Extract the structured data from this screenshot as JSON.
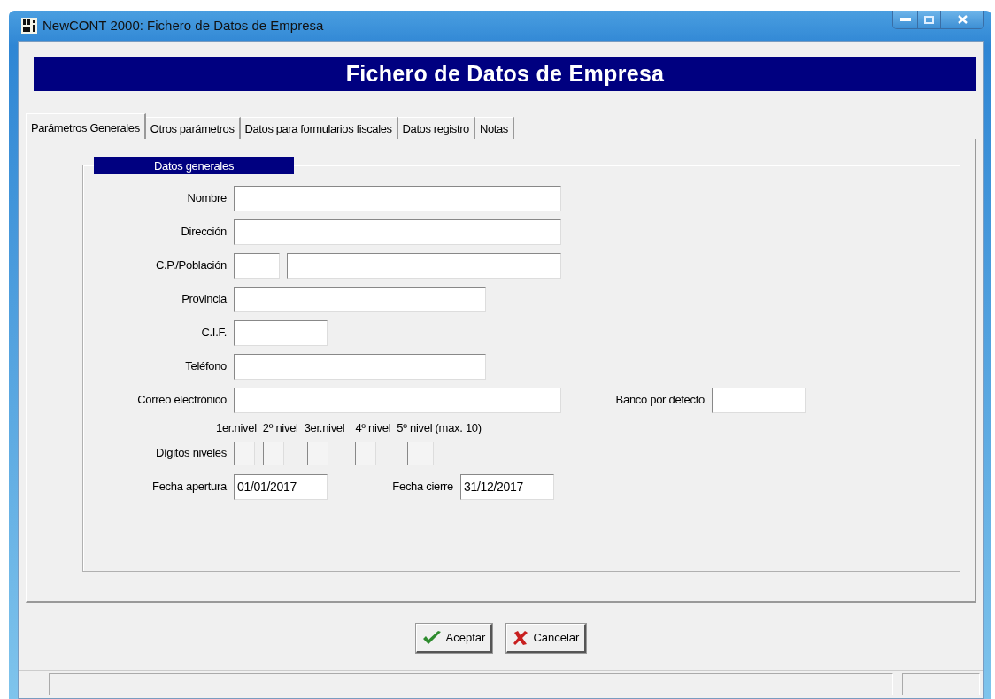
{
  "window": {
    "title": "NewCONT 2000: Fichero de Datos de Empresa"
  },
  "banner": {
    "title": "Fichero de Datos de Empresa"
  },
  "tabs": [
    {
      "label": "Parámetros Generales",
      "selected": true
    },
    {
      "label": "Otros parámetros",
      "selected": false
    },
    {
      "label": "Datos para formularios fiscales",
      "selected": false
    },
    {
      "label": "Datos registro",
      "selected": false
    },
    {
      "label": "Notas",
      "selected": false
    }
  ],
  "group": {
    "legend": "Datos generales",
    "rows": [
      {
        "label": "Nombre",
        "inputs": [
          {
            "kind": "long"
          }
        ]
      },
      {
        "label": "Dirección",
        "inputs": [
          {
            "kind": "long"
          }
        ]
      },
      {
        "label": "C.P./Población",
        "inputs": [
          {
            "kind": "tiny"
          },
          {
            "kind": "wide"
          }
        ]
      },
      {
        "label": "Provincia",
        "inputs": [
          {
            "kind": "medium"
          }
        ]
      },
      {
        "label": "C.I.F.",
        "inputs": [
          {
            "kind": "short"
          }
        ]
      },
      {
        "label": "Teléfono",
        "inputs": [
          {
            "kind": "medium"
          }
        ]
      },
      {
        "label": "Correo electrónico",
        "inputs": [
          {
            "kind": "long"
          }
        ],
        "side": {
          "label": "Banco por defecto",
          "kind": "short"
        }
      }
    ],
    "levels": {
      "label": "Dígitos niveles",
      "headings": [
        "1er.nivel",
        "2º nivel",
        "3er.nivel",
        "4º nivel",
        "5º nivel (max. 10)"
      ]
    },
    "dates": [
      {
        "label": "Fecha apertura",
        "value": "01/01/2017"
      },
      {
        "label": "Fecha cierre",
        "value": "31/12/2017"
      }
    ]
  },
  "buttons": [
    {
      "label": "Aceptar",
      "kind": "accept"
    },
    {
      "label": "Cancelar",
      "kind": "cancel"
    }
  ]
}
